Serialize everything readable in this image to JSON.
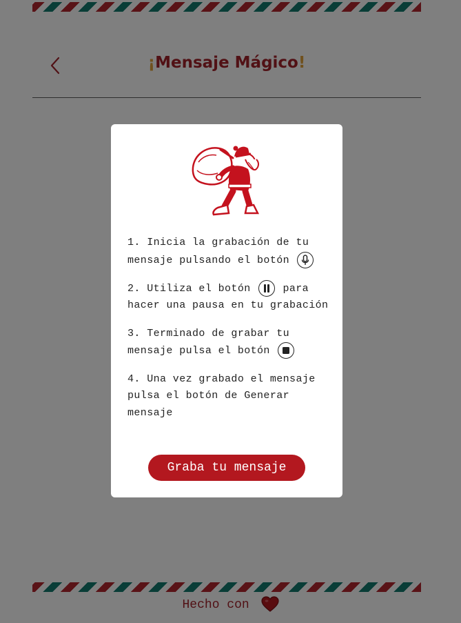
{
  "header": {
    "title_open": "¡",
    "title_text": "Mensaje Mágico",
    "title_close": "!"
  },
  "footer": {
    "text": "Hecho con"
  },
  "modal": {
    "steps": [
      {
        "text": "1. Inicia la grabación de tu mensaje pulsando el botón",
        "icon": "microphone-icon"
      },
      {
        "text_before": "2. Utiliza el botón",
        "icon": "pause-icon",
        "text_after": "para hacer una pausa en tu grabación"
      },
      {
        "text": "3. Terminado de grabar tu mensaje pulsa el botón",
        "icon": "stop-icon"
      },
      {
        "text": "4. Una vez grabado el mensaje pulsa el botón de Generar mensaje"
      }
    ],
    "record_button_label": "Graba tu mensaje"
  },
  "colors": {
    "brand_red": "#b3181f",
    "accent_gold": "#e0a23a",
    "stripe_green": "#127a6e"
  }
}
